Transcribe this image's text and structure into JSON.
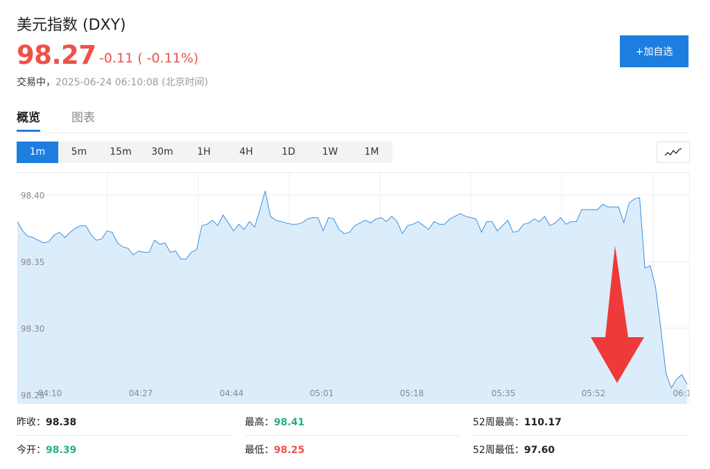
{
  "header": {
    "title": "美元指数 (DXY)",
    "price": "98.27",
    "change": "-0.11 ( -0.11%)",
    "status": "交易中，",
    "timestamp": "2025-06-24 06:10:08 (北京时间)",
    "add_button": "+加自选"
  },
  "tabs": [
    {
      "label": "概览",
      "active": true
    },
    {
      "label": "图表",
      "active": false
    }
  ],
  "periods": [
    {
      "label": "1m",
      "active": true
    },
    {
      "label": "5m",
      "active": false
    },
    {
      "label": "15m",
      "active": false
    },
    {
      "label": "30m",
      "active": false
    },
    {
      "label": "1H",
      "active": false
    },
    {
      "label": "4H",
      "active": false
    },
    {
      "label": "1D",
      "active": false
    },
    {
      "label": "1W",
      "active": false
    },
    {
      "label": "1M",
      "active": false
    }
  ],
  "chart_type_icon": "line-chart-icon",
  "chart_data": {
    "type": "area",
    "y_ticks": [
      "98.40",
      "98.35",
      "98.30",
      "98.25"
    ],
    "x_ticks": [
      "04:10",
      "04:27",
      "04:44",
      "05:01",
      "05:18",
      "05:35",
      "05:52",
      "06:1"
    ],
    "ylim": [
      98.25,
      98.41
    ],
    "grid": true,
    "line_color": "#3d8ee0",
    "fill_color": "#dbecfb",
    "annotation": "red-down-arrow",
    "values": [
      98.38,
      98.373,
      98.369,
      98.368,
      98.366,
      98.364,
      98.365,
      98.37,
      98.372,
      98.368,
      98.372,
      98.375,
      98.377,
      98.377,
      98.37,
      98.366,
      98.367,
      98.373,
      98.372,
      98.364,
      98.361,
      98.36,
      98.355,
      98.358,
      98.357,
      98.357,
      98.366,
      98.363,
      98.364,
      98.357,
      98.358,
      98.352,
      98.352,
      98.357,
      98.359,
      98.377,
      98.378,
      98.381,
      98.377,
      98.385,
      98.379,
      98.373,
      98.378,
      98.374,
      98.38,
      98.376,
      98.389,
      98.403,
      98.384,
      98.381,
      98.38,
      98.379,
      98.378,
      98.378,
      98.379,
      98.382,
      98.383,
      98.383,
      98.373,
      98.383,
      98.382,
      98.374,
      98.371,
      98.372,
      98.377,
      98.379,
      98.381,
      98.379,
      98.382,
      98.383,
      98.38,
      98.384,
      98.38,
      98.371,
      98.377,
      98.378,
      98.38,
      98.377,
      98.374,
      98.38,
      98.378,
      98.378,
      98.382,
      98.384,
      98.386,
      98.384,
      98.383,
      98.382,
      98.372,
      98.38,
      98.38,
      98.373,
      98.377,
      98.381,
      98.372,
      98.373,
      98.378,
      98.379,
      98.382,
      98.38,
      98.384,
      98.377,
      98.379,
      98.383,
      98.378,
      98.38,
      98.38,
      98.389,
      98.389,
      98.389,
      98.389,
      98.393,
      98.391,
      98.391,
      98.391,
      98.379,
      98.394,
      98.397,
      98.398,
      98.345,
      98.347,
      98.331,
      98.3,
      98.266,
      98.255,
      98.262,
      98.265,
      98.258
    ]
  },
  "stats": [
    [
      {
        "label": "昨收：",
        "value": "98.38",
        "color": "#222222"
      },
      {
        "label": "最高：",
        "value": "98.41",
        "color": "#26b07a"
      },
      {
        "label": "52周最高：",
        "value": "110.17",
        "color": "#222222"
      }
    ],
    [
      {
        "label": "今开：",
        "value": "98.39",
        "color": "#26b07a"
      },
      {
        "label": "最低：",
        "value": "98.25",
        "color": "#f0504a"
      },
      {
        "label": "52周最低：",
        "value": "97.60",
        "color": "#222222"
      }
    ]
  ]
}
